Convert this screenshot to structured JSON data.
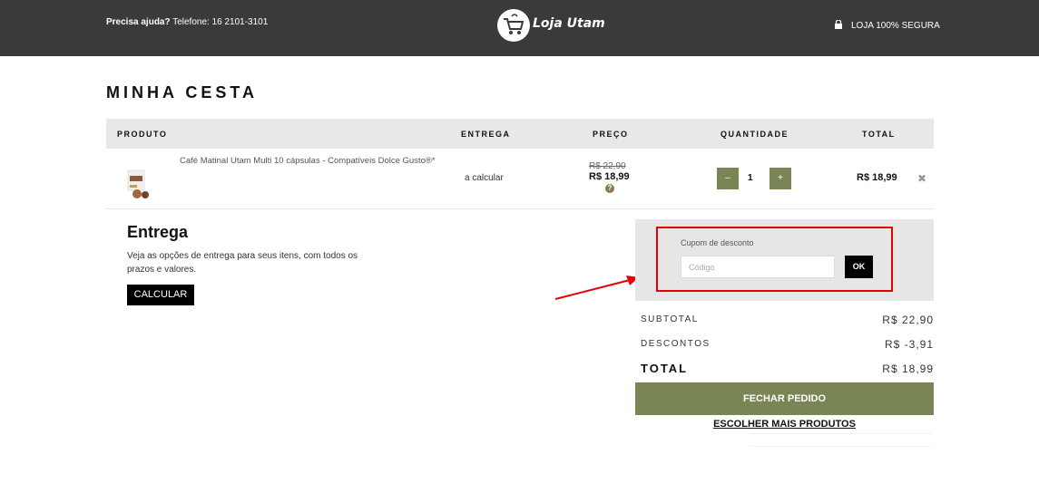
{
  "header": {
    "help_bold": "Precisa ajuda?",
    "help_text": " Telefone: 16 2101-3101",
    "logo_text": "Loja Utam",
    "secure_text": "LOJA 100% SEGURA"
  },
  "page_title": "MINHA CESTA",
  "table": {
    "headers": {
      "product": "PRODUTO",
      "delivery": "ENTREGA",
      "price": "PREÇO",
      "quantity": "QUANTIDADE",
      "total": "TOTAL"
    },
    "row": {
      "name": "Café Matinal Utam Multi 10 cápsulas - Compatíveis Dolce Gusto®*",
      "delivery": "a calcular",
      "old_price": "R$ 22,90",
      "price": "R$ 18,99",
      "price_help": "?",
      "qty_minus": "–",
      "quantity": "1",
      "qty_plus": "+",
      "total": "R$ 18,99",
      "remove": "✖"
    }
  },
  "entrega": {
    "title": "Entrega",
    "description": "Veja as opções de entrega para seus itens, com todos os prazos e valores.",
    "button": "CALCULAR"
  },
  "coupon": {
    "label": "Cupom de desconto",
    "placeholder": "Código",
    "button": "OK"
  },
  "summary": {
    "subtotal_label": "SUBTOTAL",
    "subtotal_value": "R$ 22,90",
    "discount_label": "DESCONTOS",
    "discount_value": "R$ -3,91",
    "total_label": "TOTAL",
    "total_value": "R$ 18,99"
  },
  "checkout_button": "FECHAR PEDIDO",
  "more_products_link": "ESCOLHER MAIS PRODUTOS",
  "colors": {
    "header_bg": "#3a3a3a",
    "accent_green": "#7a8555",
    "highlight_red": "#e60000"
  }
}
